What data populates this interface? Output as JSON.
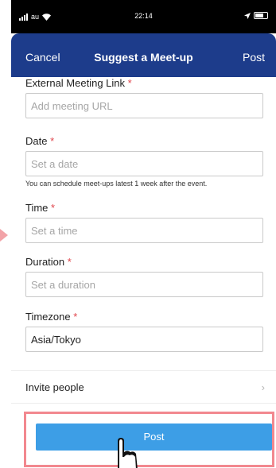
{
  "status_bar": {
    "carrier": "au",
    "time": "22:14"
  },
  "nav": {
    "cancel_label": "Cancel",
    "title": "Suggest a Meet-up",
    "post_label": "Post"
  },
  "form": {
    "required_mark": "*",
    "external_link": {
      "label": "External Meeting Link",
      "placeholder": "Add meeting URL",
      "value": ""
    },
    "date": {
      "label": "Date",
      "placeholder": "Set a date",
      "value": "",
      "helper": "You can schedule meet-ups latest 1 week after the event."
    },
    "time": {
      "label": "Time",
      "placeholder": "Set a time",
      "value": ""
    },
    "duration": {
      "label": "Duration",
      "placeholder": "Set a duration",
      "value": ""
    },
    "timezone": {
      "label": "Timezone",
      "value": "Asia/Tokyo"
    }
  },
  "invite": {
    "label": "Invite people",
    "chevron": "›"
  },
  "footer": {
    "post_button_label": "Post"
  },
  "colors": {
    "nav_background": "#1d3c8b",
    "post_button": "#3d9ee6",
    "required": "#e0444b",
    "highlight": "#f2888f"
  },
  "icons": [
    "signal-icon",
    "wifi-icon",
    "location-arrow-icon",
    "battery-icon",
    "chevron-right-icon",
    "pointer-hand-icon",
    "side-arrow-icon"
  ]
}
